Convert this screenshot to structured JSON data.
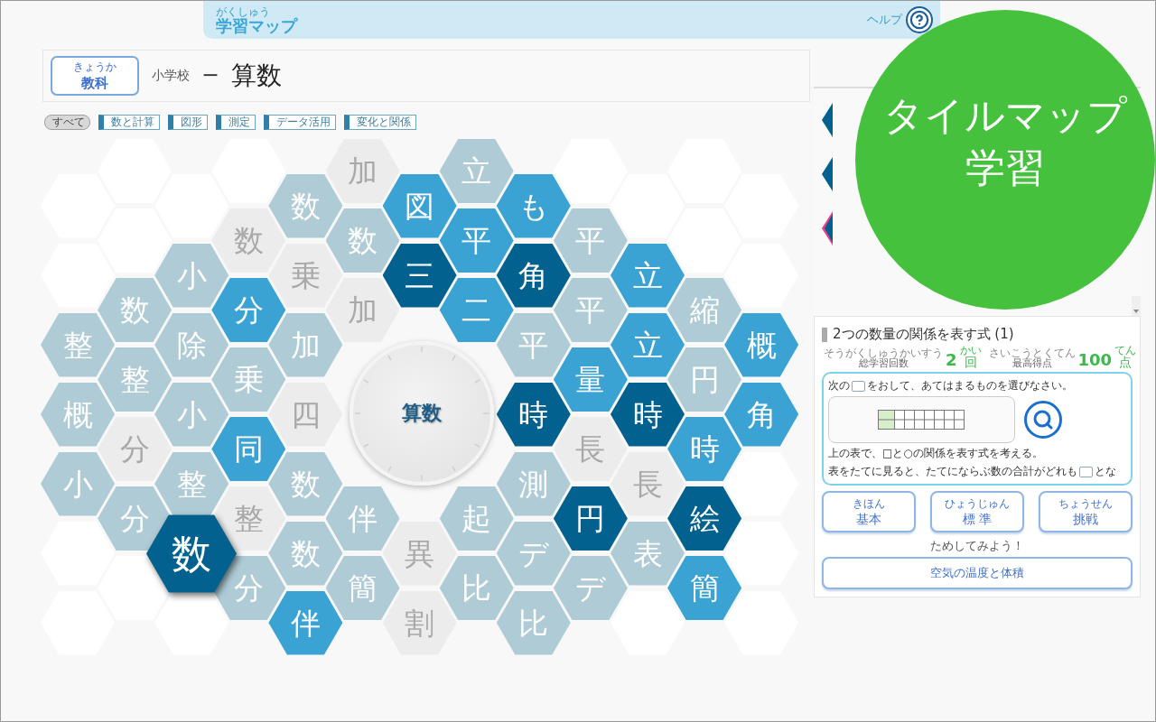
{
  "header": {
    "title": "学習マップ",
    "title_furigana": "がくしゅう",
    "help_label": "ヘルプ"
  },
  "subject_bar": {
    "button": {
      "label": "教科",
      "furigana": "きょうか"
    },
    "school": "小学校",
    "dash": "ー",
    "subject": "算数"
  },
  "filters": [
    {
      "label": "すべて",
      "selected": true
    },
    {
      "label": "数と計算",
      "selected": false
    },
    {
      "label": "図形",
      "selected": false
    },
    {
      "label": "測定",
      "selected": false
    },
    {
      "label": "データ活用",
      "selected": false
    },
    {
      "label": "変化と関係",
      "selected": false
    }
  ],
  "hex_map": {
    "center_label": "算数",
    "columns": [
      [
        {
          "kind": "blank"
        },
        {
          "kind": "blank"
        },
        {
          "kind": "pale",
          "char": "整",
          "selected": false
        },
        {
          "kind": "pale",
          "char": "概",
          "selected": false
        },
        {
          "kind": "pale",
          "char": "小",
          "selected": false
        },
        {
          "kind": "blank"
        },
        {
          "kind": "blank"
        }
      ],
      [
        {
          "kind": "blank"
        },
        {
          "kind": "blank"
        },
        {
          "kind": "pale",
          "char": "数",
          "selected": false
        },
        {
          "kind": "pale",
          "char": "整",
          "selected": false
        },
        {
          "kind": "grey",
          "char": "分",
          "selected": false
        },
        {
          "kind": "pale",
          "char": "分",
          "selected": false
        },
        {
          "kind": "blank"
        }
      ],
      [
        {
          "kind": "blank"
        },
        {
          "kind": "pale",
          "char": "小",
          "selected": false
        },
        {
          "kind": "pale",
          "char": "除",
          "selected": false
        },
        {
          "kind": "pale",
          "char": "小",
          "selected": false
        },
        {
          "kind": "pale",
          "char": "整",
          "selected": false
        },
        {
          "kind": "dark",
          "char": "数",
          "selected": true
        },
        {
          "kind": "blank"
        }
      ],
      [
        {
          "kind": "blank"
        },
        {
          "kind": "grey",
          "char": "数",
          "selected": false
        },
        {
          "kind": "mid",
          "char": "分",
          "selected": false
        },
        {
          "kind": "pale",
          "char": "乗",
          "selected": false
        },
        {
          "kind": "mid",
          "char": "同",
          "selected": false
        },
        {
          "kind": "grey",
          "char": "整",
          "selected": false
        },
        {
          "kind": "pale",
          "char": "分",
          "selected": false
        }
      ],
      [
        {
          "kind": "pale",
          "char": "数",
          "selected": false
        },
        {
          "kind": "grey",
          "char": "乗",
          "selected": false
        },
        {
          "kind": "pale",
          "char": "加",
          "selected": false
        },
        {
          "kind": "grey",
          "char": "四",
          "selected": false
        },
        {
          "kind": "pale",
          "char": "数",
          "selected": false
        },
        {
          "kind": "pale",
          "char": "数",
          "selected": false
        },
        {
          "kind": "mid",
          "char": "伴",
          "selected": false
        }
      ],
      [
        {
          "kind": "grey",
          "char": "加",
          "selected": false
        },
        {
          "kind": "pale",
          "char": "数",
          "selected": false
        },
        {
          "kind": "grey",
          "char": "加",
          "selected": false
        },
        {
          "kind": "empty"
        },
        {
          "kind": "empty"
        },
        {
          "kind": "pale",
          "char": "伴",
          "selected": false
        },
        {
          "kind": "pale",
          "char": "簡",
          "selected": false
        }
      ],
      [
        {
          "kind": "mid",
          "char": "図",
          "selected": false
        },
        {
          "kind": "dark",
          "char": "三",
          "selected": false
        },
        {
          "kind": "empty"
        },
        {
          "kind": "empty"
        },
        {
          "kind": "empty"
        },
        {
          "kind": "grey",
          "char": "異",
          "selected": false
        },
        {
          "kind": "grey",
          "char": "割",
          "selected": false
        }
      ],
      [
        {
          "kind": "pale",
          "char": "立",
          "selected": false
        },
        {
          "kind": "mid",
          "char": "平",
          "selected": false
        },
        {
          "kind": "mid",
          "char": "二",
          "selected": false
        },
        {
          "kind": "empty"
        },
        {
          "kind": "empty"
        },
        {
          "kind": "pale",
          "char": "起",
          "selected": false
        },
        {
          "kind": "pale",
          "char": "比",
          "selected": false
        }
      ],
      [
        {
          "kind": "mid",
          "char": "も",
          "selected": false
        },
        {
          "kind": "dark",
          "char": "角",
          "selected": false
        },
        {
          "kind": "pale",
          "char": "平",
          "selected": false
        },
        {
          "kind": "dark",
          "char": "時",
          "selected": false
        },
        {
          "kind": "pale",
          "char": "測",
          "selected": false
        },
        {
          "kind": "pale",
          "char": "デ",
          "selected": false
        },
        {
          "kind": "pale",
          "char": "比",
          "selected": false
        }
      ],
      [
        {
          "kind": "blank"
        },
        {
          "kind": "pale",
          "char": "平",
          "selected": false
        },
        {
          "kind": "pale",
          "char": "平",
          "selected": false
        },
        {
          "kind": "mid",
          "char": "量",
          "selected": false
        },
        {
          "kind": "grey",
          "char": "長",
          "selected": false
        },
        {
          "kind": "dark",
          "char": "円",
          "selected": false
        },
        {
          "kind": "pale",
          "char": "デ",
          "selected": false
        }
      ],
      [
        {
          "kind": "blank"
        },
        {
          "kind": "mid",
          "char": "立",
          "selected": false
        },
        {
          "kind": "mid",
          "char": "立",
          "selected": false
        },
        {
          "kind": "dark",
          "char": "時",
          "selected": false
        },
        {
          "kind": "grey",
          "char": "長",
          "selected": false
        },
        {
          "kind": "pale",
          "char": "表",
          "selected": false
        },
        {
          "kind": "blank"
        }
      ],
      [
        {
          "kind": "blank"
        },
        {
          "kind": "blank"
        },
        {
          "kind": "pale",
          "char": "縮",
          "selected": false
        },
        {
          "kind": "pale",
          "char": "円",
          "selected": false
        },
        {
          "kind": "mid",
          "char": "時",
          "selected": false
        },
        {
          "kind": "dark",
          "char": "絵",
          "selected": false
        },
        {
          "kind": "mid",
          "char": "簡",
          "selected": false
        }
      ],
      [
        {
          "kind": "blank"
        },
        {
          "kind": "blank"
        },
        {
          "kind": "mid",
          "char": "概",
          "selected": false
        },
        {
          "kind": "mid",
          "char": "角",
          "selected": false
        },
        {
          "kind": "blank"
        },
        {
          "kind": "blank"
        },
        {
          "kind": "blank"
        }
      ]
    ]
  },
  "lesson_tiles": [
    {
      "selected": false
    },
    {
      "selected": false
    },
    {
      "selected": true
    }
  ],
  "lesson": {
    "title": "2つの数量の関係を表す式 (1)",
    "stats": [
      {
        "label": "総学習回数",
        "label_furigana": "そうがくしゅうかいすう",
        "value": "2",
        "unit": "回",
        "unit_furigana": "かい"
      },
      {
        "label": "最高得点",
        "label_furigana": "さいこうとくてん",
        "value": "100",
        "unit": "点",
        "unit_furigana": "てん"
      }
    ],
    "preview": {
      "line1_before": "次の",
      "line1_after": "をおして、あてはまるものを選びなさい。",
      "line2": "上の表で、□と○の関係を表す式を考える。",
      "line3_before": "表をたてに見ると、たてにならぶ数の合計がどれも",
      "line3_after": "とな"
    },
    "levels": [
      {
        "label": "基本",
        "furigana": "きほん"
      },
      {
        "label": "標 準",
        "furigana": "ひょうじゅん"
      },
      {
        "label": "挑戦",
        "furigana": "ちょうせん"
      }
    ],
    "try_label": "ためしてみよう！",
    "try_button": "空気の温度と体積"
  },
  "badge": {
    "lines": [
      "タイルマップ",
      "学習"
    ]
  }
}
